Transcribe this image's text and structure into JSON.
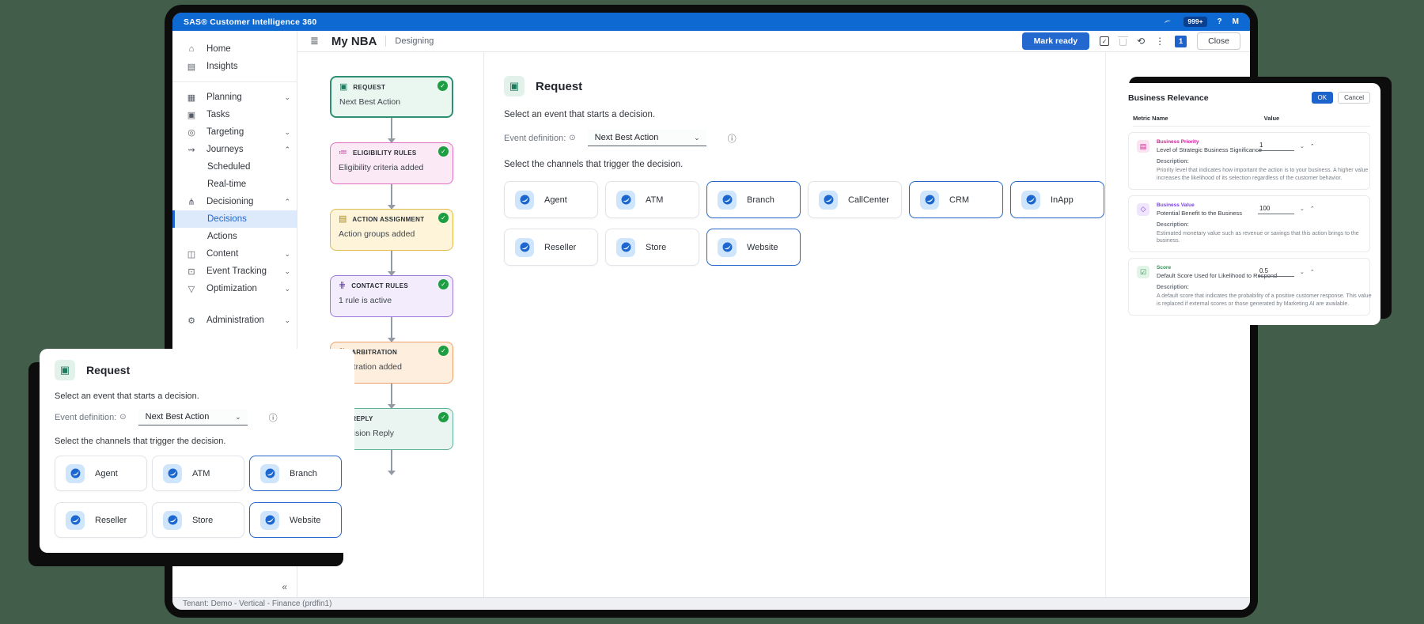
{
  "top_bar": {
    "title": "SAS® Customer Intelligence 360",
    "notifications_badge": "999+",
    "help_label": "?",
    "avatar_initial": "M"
  },
  "toolbar": {
    "workflow_name": "My NBA",
    "status": "Designing",
    "mark_ready_label": "Mark ready",
    "validate_glyph": "✓",
    "refresh_glyph": "⟲",
    "kebab_glyph": "⋮",
    "version_badge": "1",
    "close_label": "Close",
    "list_icon_glyph": "≣"
  },
  "sidebar": {
    "collapse_glyph": "«",
    "items": [
      {
        "label": "Home",
        "glyph": "⌂"
      },
      {
        "label": "Insights",
        "glyph": "▤"
      },
      {
        "divider": true
      },
      {
        "label": "Planning",
        "glyph": "▦",
        "chevron": "⌄"
      },
      {
        "label": "Tasks",
        "glyph": "▣"
      },
      {
        "label": "Targeting",
        "glyph": "◎",
        "chevron": "⌄"
      },
      {
        "label": "Journeys",
        "glyph": "⇝",
        "chevron": "⌃"
      },
      {
        "label": "Scheduled",
        "child": true
      },
      {
        "label": "Real-time",
        "child": true
      },
      {
        "label": "Decisioning",
        "glyph": "⋔",
        "chevron": "⌃"
      },
      {
        "label": "Decisions",
        "child": true,
        "selected": true
      },
      {
        "label": "Actions",
        "child": true
      },
      {
        "label": "Content",
        "glyph": "◫",
        "chevron": "⌄"
      },
      {
        "label": "Event Tracking",
        "glyph": "⊡",
        "chevron": "⌄"
      },
      {
        "label": "Optimization",
        "glyph": "▽",
        "chevron": "⌄"
      },
      {
        "label": "Administration",
        "glyph": "⚙",
        "chevron": "⌄",
        "gap": true
      }
    ]
  },
  "canvas": {
    "nodes": [
      {
        "title": "REQUEST",
        "subtitle": "Next Best Action",
        "glyph": "▣",
        "border": "#2f8f72",
        "bg": "#eaf6f0",
        "icon_color": "#1d7a5f",
        "selected": true,
        "check": "✓"
      },
      {
        "title": "ELIGIBILITY RULES",
        "subtitle": "Eligibility criteria added",
        "glyph": "≔",
        "border": "#e06fc0",
        "bg": "#fbe9f5",
        "icon_color": "#c2379d",
        "check": "✓"
      },
      {
        "title": "ACTION ASSIGNMENT",
        "subtitle": "Action groups added",
        "glyph": "▤",
        "border": "#e0bc4e",
        "bg": "#fdf4d9",
        "icon_color": "#a8851a",
        "check": "✓"
      },
      {
        "title": "CONTACT RULES",
        "subtitle": "1 rule is active",
        "glyph": "⋕",
        "border": "#9b78dc",
        "bg": "#f2ecfc",
        "icon_color": "#6d3fc0",
        "check": "✓"
      },
      {
        "title": "ARBITRATION",
        "subtitle": "Arbitration added",
        "glyph": "⇅",
        "border": "#eda06a",
        "bg": "#fdeede",
        "icon_color": "#c06a24",
        "check": "✓"
      },
      {
        "title": "REPLY",
        "subtitle": "Decision Reply",
        "glyph": "↩",
        "border": "#63b29b",
        "bg": "#eaf4f0",
        "icon_color": "#1d7a5f",
        "check": "✓"
      }
    ]
  },
  "request_panel": {
    "icon_glyph": "▣",
    "title": "Request",
    "event_prompt": "Select an event that starts a decision.",
    "event_definition_label": "Event definition:",
    "lock_glyph": "⊙",
    "event_definition_value": "Next Best Action",
    "dropdown_chevron": "⌄",
    "info_glyph": "ⓘ",
    "channels_prompt": "Select the channels that trigger the decision.",
    "channels": [
      {
        "label": "Agent"
      },
      {
        "label": "ATM"
      },
      {
        "label": "Branch",
        "selected": true
      },
      {
        "label": "CallCenter"
      },
      {
        "label": "CRM",
        "selected": true
      },
      {
        "label": "InApp",
        "selected": true
      },
      {
        "label": "Reseller"
      },
      {
        "label": "Store"
      },
      {
        "label": "Website",
        "selected": true
      }
    ]
  },
  "request_popup": {
    "icon_glyph": "▣",
    "title": "Request",
    "event_prompt": "Select an event that starts a decision.",
    "event_definition_label": "Event definition:",
    "lock_glyph": "⊙",
    "event_definition_value": "Next Best Action",
    "dropdown_chevron": "⌄",
    "info_glyph": "ⓘ",
    "channels_prompt": "Select the channels that trigger the decision.",
    "channels": [
      {
        "label": "Agent"
      },
      {
        "label": "ATM"
      },
      {
        "label": "Branch",
        "selected": true
      },
      {
        "label": "Reseller"
      },
      {
        "label": "Store"
      },
      {
        "label": "Website",
        "selected": true
      }
    ]
  },
  "business_relevance": {
    "title": "Business Relevance",
    "ok_label": "OK",
    "cancel_label": "Cancel",
    "metric_column": "Metric Name",
    "value_column": "Value",
    "spin_down": "⌄",
    "spin_up": "⌃",
    "metrics": [
      {
        "name": "Business Priority",
        "subtitle": "Level of Strategic Business Significance",
        "value": "1",
        "glyph": "▤",
        "color": "#cf1f96",
        "tint": "#fbe3f2",
        "description_label": "Description:",
        "description": "Priority level that indicates how important the action is to your business. A higher value increases the likelihood of its selection regardless of the customer behavior."
      },
      {
        "name": "Business Value",
        "subtitle": "Potential Benefit to the Business",
        "value": "100",
        "glyph": "◇",
        "color": "#7b3bf2",
        "tint": "#efe6fd",
        "description_label": "Description:",
        "description": "Estimated monetary value such as revenue or savings that this action brings to the business."
      },
      {
        "name": "Score",
        "subtitle": "Default Score Used for Likelihood to Respond",
        "value": "0.5",
        "glyph": "☑",
        "color": "#2b9150",
        "tint": "#e2f3e8",
        "description_label": "Description:",
        "description": "A default score that indicates the probability of a positive customer response. This value is replaced if external scores or those generated by Marketing AI are available."
      }
    ]
  },
  "status_bar": {
    "tenant": "Tenant: Demo - Vertical - Finance (prdfin1)"
  }
}
